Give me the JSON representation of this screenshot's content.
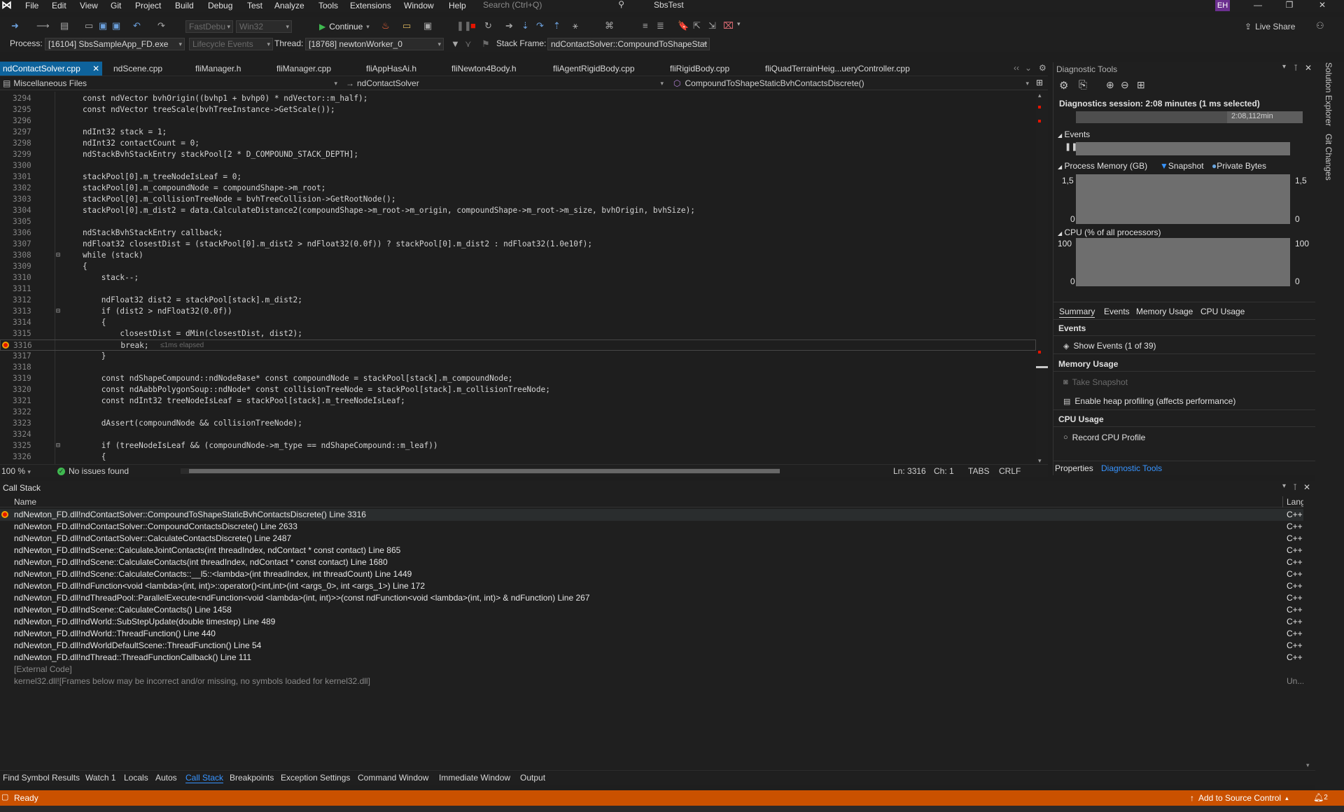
{
  "menu": {
    "items": [
      "File",
      "Edit",
      "View",
      "Git",
      "Project",
      "Build",
      "Debug",
      "Test",
      "Analyze",
      "Tools",
      "Extensions",
      "Window",
      "Help"
    ],
    "search_placeholder": "Search (Ctrl+Q)",
    "solution": "SbsTest",
    "user_initials": "EH"
  },
  "toolbar": {
    "config": "FastDebu",
    "platform": "Win32",
    "continue": "Continue",
    "live_share": "Live Share"
  },
  "debug_location": {
    "process_label": "Process:",
    "process": "[16104] SbsSampleApp_FD.exe",
    "lifecycle": "Lifecycle Events",
    "thread_label": "Thread:",
    "thread": "[18768] newtonWorker_0",
    "stack_frame_label": "Stack Frame:",
    "stack_frame": "ndContactSolver::CompoundToShapeStat"
  },
  "doc_tabs": [
    "ndContactSolver.cpp",
    "ndScene.cpp",
    "fliManager.h",
    "fliManager.cpp",
    "fliAppHasAi.h",
    "fliNewton4Body.h",
    "fliAgentRigidBody.cpp",
    "fliRigidBody.cpp",
    "fliQuadTerrainHeig...ueryController.cpp"
  ],
  "nav": {
    "project": "Miscellaneous Files",
    "scope": "ndContactSolver",
    "member": "CompoundToShapeStaticBvhContactsDiscrete()"
  },
  "code": [
    {
      "n": "3294",
      "t": "const ndVector bvhOrigin((bvhp1 + bvhp0) * ndVector::m_half);"
    },
    {
      "n": "3295",
      "t": "const ndVector treeScale(bvhTreeInstance->GetScale());"
    },
    {
      "n": "3296",
      "t": ""
    },
    {
      "n": "3297",
      "t": "ndInt32 stack = 1;"
    },
    {
      "n": "3298",
      "t": "ndInt32 contactCount = 0;"
    },
    {
      "n": "3299",
      "t": "ndStackBvhStackEntry stackPool[2 * D_COMPOUND_STACK_DEPTH];"
    },
    {
      "n": "3300",
      "t": ""
    },
    {
      "n": "3301",
      "t": "stackPool[0].m_treeNodeIsLeaf = 0;"
    },
    {
      "n": "3302",
      "t": "stackPool[0].m_compoundNode = compoundShape->m_root;"
    },
    {
      "n": "3303",
      "t": "stackPool[0].m_collisionTreeNode = bvhTreeCollision->GetRootNode();"
    },
    {
      "n": "3304",
      "t": "stackPool[0].m_dist2 = data.CalculateDistance2(compoundShape->m_root->m_origin, compoundShape->m_root->m_size, bvhOrigin, bvhSize);"
    },
    {
      "n": "3305",
      "t": ""
    },
    {
      "n": "3306",
      "t": "ndStackBvhStackEntry callback;"
    },
    {
      "n": "3307",
      "t": "ndFloat32 closestDist = (stackPool[0].m_dist2 > ndFloat32(0.0f)) ? stackPool[0].m_dist2 : ndFloat32(1.0e10f);"
    },
    {
      "n": "3308",
      "t": "while (stack)"
    },
    {
      "n": "3309",
      "t": "{"
    },
    {
      "n": "3310",
      "t": "    stack--;"
    },
    {
      "n": "3311",
      "t": ""
    },
    {
      "n": "3312",
      "t": "    ndFloat32 dist2 = stackPool[stack].m_dist2;"
    },
    {
      "n": "3313",
      "t": "    if (dist2 > ndFloat32(0.0f))"
    },
    {
      "n": "3314",
      "t": "    {"
    },
    {
      "n": "3315",
      "t": "        closestDist = dMin(closestDist, dist2);"
    },
    {
      "n": "3316",
      "t": "        break;"
    },
    {
      "n": "3317",
      "t": "    }"
    },
    {
      "n": "3318",
      "t": ""
    },
    {
      "n": "3319",
      "t": "    const ndShapeCompound::ndNodeBase* const compoundNode = stackPool[stack].m_compoundNode;"
    },
    {
      "n": "3320",
      "t": "    const ndAabbPolygonSoup::ndNode* const collisionTreeNode = stackPool[stack].m_collisionTreeNode;"
    },
    {
      "n": "3321",
      "t": "    const ndInt32 treeNodeIsLeaf = stackPool[stack].m_treeNodeIsLeaf;"
    },
    {
      "n": "3322",
      "t": ""
    },
    {
      "n": "3323",
      "t": "    dAssert(compoundNode && collisionTreeNode);"
    },
    {
      "n": "3324",
      "t": ""
    },
    {
      "n": "3325",
      "t": "    if (treeNodeIsLeaf && (compoundNode->m_type == ndShapeCompound::m_leaf))"
    },
    {
      "n": "3326",
      "t": "    {"
    }
  ],
  "perf_tip": "≤1ms elapsed",
  "editor_status": {
    "zoom": "100 %",
    "issues": "No issues found",
    "line": "Ln: 3316",
    "col": "Ch: 1",
    "tabs": "TABS",
    "eol": "CRLF"
  },
  "diag": {
    "title": "Diagnostic Tools",
    "session": "Diagnostics session: 2:08 minutes (1 ms selected)",
    "timeline_label": "2:08,112min",
    "events_header": "Events",
    "process_memory": "Process Memory (GB)",
    "snapshot_legend": "Snapshot",
    "private_bytes_legend": "Private Bytes",
    "mem_max": "1,5",
    "mem_min": "0",
    "cpu_header": "CPU (% of all processors)",
    "cpu_max": "100",
    "cpu_min": "0",
    "tabs": [
      "Summary",
      "Events",
      "Memory Usage",
      "CPU Usage"
    ],
    "events_section": "Events",
    "show_events": "Show Events (1 of 39)",
    "memory_section": "Memory Usage",
    "take_snapshot": "Take Snapshot",
    "heap_profiling": "Enable heap profiling (affects performance)",
    "cpu_section": "CPU Usage",
    "record_cpu": "Record CPU Profile",
    "bottom_tabs": [
      "Properties",
      "Diagnostic Tools"
    ]
  },
  "rail": [
    "Solution Explorer",
    "Git Changes"
  ],
  "callstack": {
    "title": "Call Stack",
    "col_name": "Name",
    "col_lang": "Lang",
    "rows": [
      {
        "name": "ndNewton_FD.dll!ndContactSolver::CompoundToShapeStaticBvhContactsDiscrete() Line 3316",
        "lang": "C++"
      },
      {
        "name": "ndNewton_FD.dll!ndContactSolver::CompoundContactsDiscrete() Line 2633",
        "lang": "C++"
      },
      {
        "name": "ndNewton_FD.dll!ndContactSolver::CalculateContactsDiscrete() Line 2487",
        "lang": "C++"
      },
      {
        "name": "ndNewton_FD.dll!ndScene::CalculateJointContacts(int threadIndex, ndContact * const contact) Line 865",
        "lang": "C++"
      },
      {
        "name": "ndNewton_FD.dll!ndScene::CalculateContacts(int threadIndex, ndContact * const contact) Line 1680",
        "lang": "C++"
      },
      {
        "name": "ndNewton_FD.dll!ndScene::CalculateContacts::__l5::<lambda>(int threadIndex, int threadCount) Line 1449",
        "lang": "C++"
      },
      {
        "name": "ndNewton_FD.dll!ndFunction<void <lambda>(int, int)>::operator()<int,int>(int <args_0>, int <args_1>) Line 172",
        "lang": "C++"
      },
      {
        "name": "ndNewton_FD.dll!ndThreadPool::ParallelExecute<ndFunction<void <lambda>(int, int)>>(const ndFunction<void <lambda>(int, int)> & ndFunction) Line 267",
        "lang": "C++"
      },
      {
        "name": "ndNewton_FD.dll!ndScene::CalculateContacts() Line 1458",
        "lang": "C++"
      },
      {
        "name": "ndNewton_FD.dll!ndWorld::SubStepUpdate(double timestep) Line 489",
        "lang": "C++"
      },
      {
        "name": "ndNewton_FD.dll!ndWorld::ThreadFunction() Line 440",
        "lang": "C++"
      },
      {
        "name": "ndNewton_FD.dll!ndWorldDefaultScene::ThreadFunction() Line 54",
        "lang": "C++"
      },
      {
        "name": "ndNewton_FD.dll!ndThread::ThreadFunctionCallback() Line 111",
        "lang": "C++"
      },
      {
        "name": "[External Code]",
        "lang": ""
      },
      {
        "name": "kernel32.dll![Frames below may be incorrect and/or missing, no symbols loaded for kernel32.dll]",
        "lang": "Un..."
      }
    ]
  },
  "bottom_tabs": [
    "Find Symbol Results",
    "Watch 1",
    "Locals",
    "Autos",
    "Call Stack",
    "Breakpoints",
    "Exception Settings",
    "Command Window",
    "Immediate Window",
    "Output"
  ],
  "status": {
    "ready": "Ready",
    "source_control": "Add to Source Control",
    "notifications": "2"
  },
  "colors": {
    "accent": "#0e639c",
    "status_bar": "#ca5100",
    "breakpoint": "#e51400"
  }
}
